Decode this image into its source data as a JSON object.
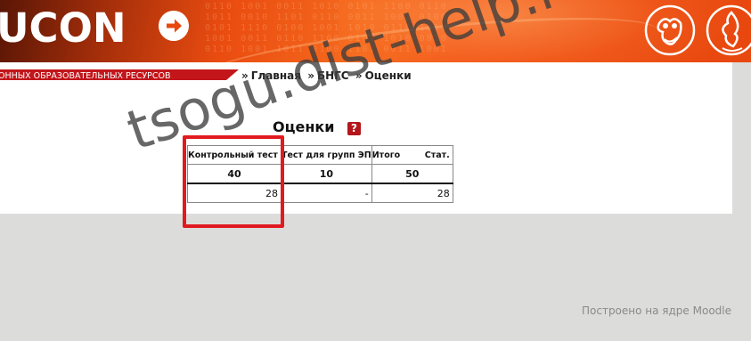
{
  "header": {
    "logo_text": "UCON",
    "emblem_left": "owl-emblem-icon",
    "emblem_right": "flame-emblem-icon",
    "accent_color": "#ec4f14"
  },
  "navbar": {
    "section_label": "ОННЫХ ОБРАЗОВАТЕЛЬНЫХ РЕСУРСОВ",
    "breadcrumb": [
      {
        "sep": "»",
        "label": "Главная"
      },
      {
        "sep": "»",
        "label": "БНГС"
      },
      {
        "sep": "»",
        "label": "Оценки"
      }
    ],
    "tab_color": "#c2161b"
  },
  "main": {
    "title": "Оценки",
    "help_icon": "?",
    "table": {
      "headers": [
        "Контрольный тест",
        "Тест для групп ЭП",
        "Итого",
        "Стат."
      ],
      "max_row": [
        "40",
        "10",
        "50"
      ],
      "value_row": [
        "28",
        "-",
        "28"
      ]
    }
  },
  "watermark": "tsogu.dist-help.ru",
  "footer": "Построено на ядре Moodle"
}
